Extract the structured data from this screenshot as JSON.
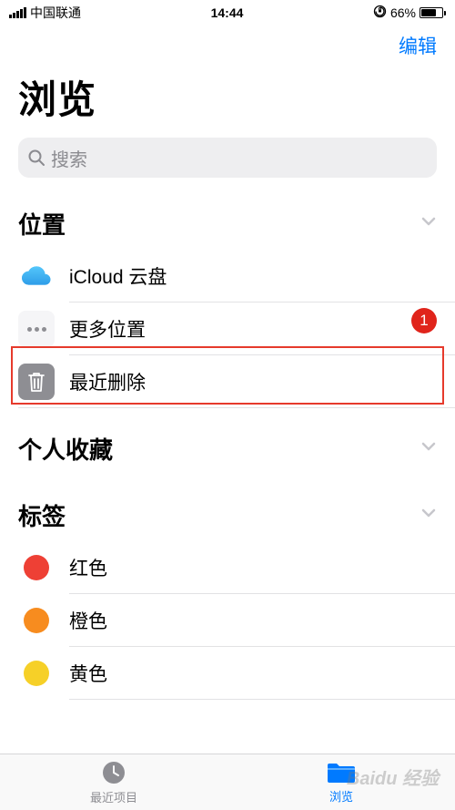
{
  "status": {
    "carrier": "中国联通",
    "time": "14:44",
    "battery_pct": "66%"
  },
  "nav": {
    "edit": "编辑"
  },
  "title": "浏览",
  "search": {
    "placeholder": "搜索"
  },
  "sections": {
    "locations": {
      "title": "位置",
      "items": [
        {
          "label": "iCloud 云盘"
        },
        {
          "label": "更多位置"
        },
        {
          "label": "最近删除"
        }
      ]
    },
    "favorites": {
      "title": "个人收藏"
    },
    "tags": {
      "title": "标签",
      "items": [
        {
          "label": "红色",
          "color": "#ee4035"
        },
        {
          "label": "橙色",
          "color": "#f78c1f"
        },
        {
          "label": "黄色",
          "color": "#f6d028"
        }
      ]
    }
  },
  "badge": "1",
  "tabs": {
    "recent": "最近项目",
    "browse": "浏览"
  },
  "watermark": "Baidu 经验"
}
